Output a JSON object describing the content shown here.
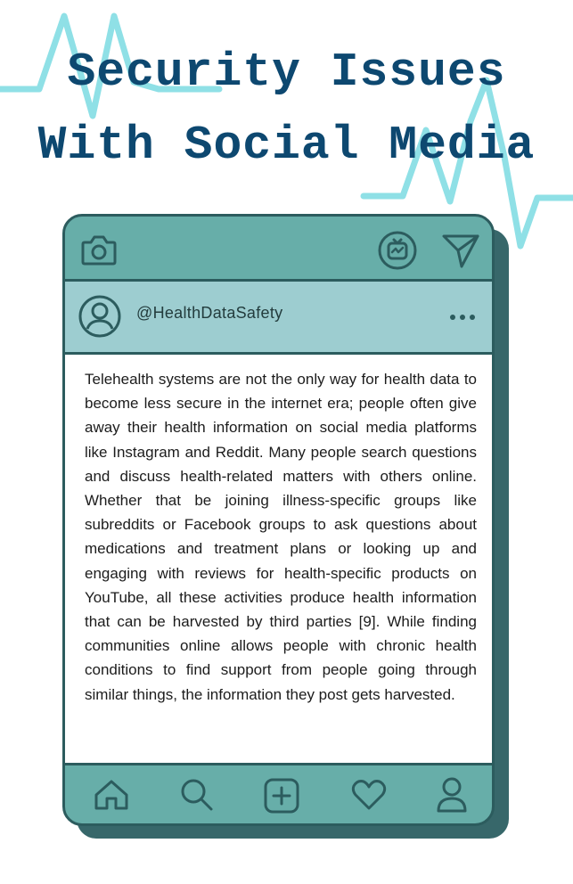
{
  "title": {
    "line1": "Security Issues",
    "line2": "With Social Media"
  },
  "colors": {
    "title": "#0d4870",
    "accent_pulse": "#8fe0e6",
    "phone_body": "#67aea9",
    "phone_border": "#2c5c5e",
    "phone_shadow": "#37676a",
    "profile_bar": "#9dcdd0"
  },
  "phone": {
    "top_bar": {
      "left_icon": "camera-icon",
      "right_icons": [
        "igtv-icon",
        "send-icon"
      ]
    },
    "profile": {
      "avatar_icon": "user-circle-icon",
      "handle": "@HealthDataSafety",
      "menu_icon": "more-dots-icon"
    },
    "post": {
      "text": "Telehealth systems are not the only way for health data to become less secure in the internet era; people often give away their health information on social media platforms like Instagram and Reddit. Many people search questions and discuss health-related matters with others online. Whether that be joining illness-specific groups like subreddits or Facebook groups to ask questions about medications and treatment plans or looking up and engaging with reviews for health-specific products on YouTube, all these activities produce health information that can be harvested by third parties [9]. While finding communities online allows people with chronic health conditions to find support from people going through similar things, the information they post gets harvested."
    },
    "nav": [
      "home-icon",
      "search-icon",
      "add-post-icon",
      "heart-icon",
      "profile-icon"
    ]
  }
}
